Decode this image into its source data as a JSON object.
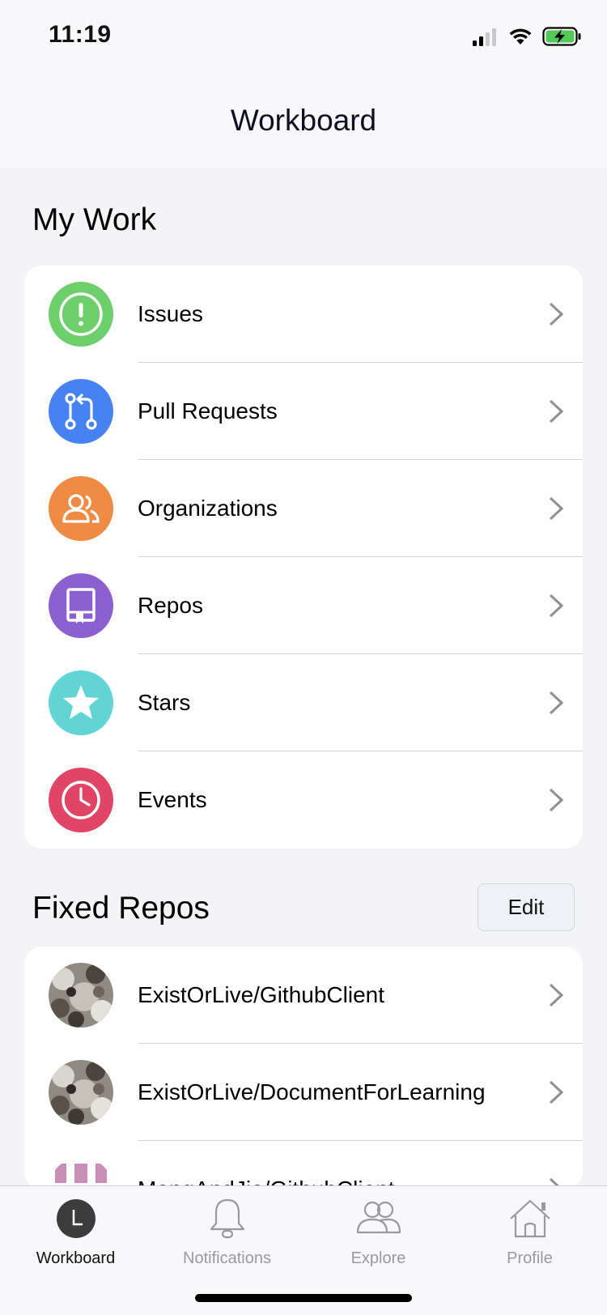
{
  "status": {
    "time": "11:19"
  },
  "nav": {
    "title": "Workboard"
  },
  "my_work": {
    "title": "My Work",
    "items": [
      {
        "label": "Issues",
        "icon": "issues-icon",
        "color": "#6ccf6c"
      },
      {
        "label": "Pull Requests",
        "icon": "pull-request-icon",
        "color": "#4483f1"
      },
      {
        "label": "Organizations",
        "icon": "organizations-icon",
        "color": "#ef8b45"
      },
      {
        "label": "Repos",
        "icon": "repo-icon",
        "color": "#8b5fd0"
      },
      {
        "label": "Stars",
        "icon": "star-icon",
        "color": "#62d4d3"
      },
      {
        "label": "Events",
        "icon": "clock-icon",
        "color": "#e04565"
      }
    ]
  },
  "fixed_repos": {
    "title": "Fixed Repos",
    "edit_label": "Edit",
    "items": [
      {
        "label": "ExistOrLive/GithubClient"
      },
      {
        "label": "ExistOrLive/DocumentForLearning"
      },
      {
        "label": "MengAndJie/GithubClient"
      }
    ]
  },
  "tabs": [
    {
      "label": "Workboard",
      "icon": "workboard-icon",
      "active": true
    },
    {
      "label": "Notifications",
      "icon": "bell-icon",
      "active": false
    },
    {
      "label": "Explore",
      "icon": "people-icon",
      "active": false
    },
    {
      "label": "Profile",
      "icon": "house-icon",
      "active": false
    }
  ]
}
